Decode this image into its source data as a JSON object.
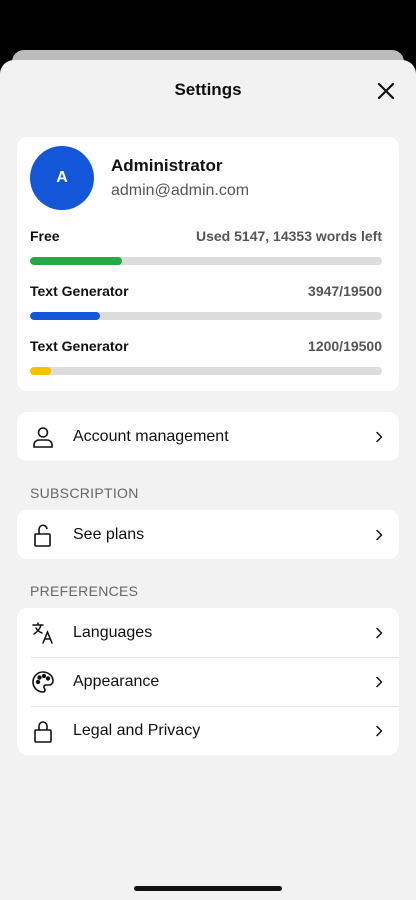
{
  "header": {
    "title": "Settings"
  },
  "profile": {
    "initial": "A",
    "name": "Administrator",
    "email": "admin@admin.com"
  },
  "usage": [
    {
      "label": "Free",
      "value": "Used 5147, 14353 words left",
      "fraction": 0.26,
      "color": "#27a844"
    },
    {
      "label": "Text Generator",
      "value": "3947/19500",
      "fraction": 0.2,
      "color": "#1357d8"
    },
    {
      "label": "Text Generator",
      "value": "1200/19500",
      "fraction": 0.06,
      "color": "#f5c000"
    }
  ],
  "account": {
    "label": "Account management",
    "icon": "person-icon"
  },
  "subscription": {
    "section_label": "SUBSCRIPTION",
    "items": [
      {
        "label": "See plans",
        "icon": "unlock-icon"
      }
    ]
  },
  "preferences": {
    "section_label": "PREFERENCES",
    "items": [
      {
        "label": "Languages",
        "icon": "translate-icon"
      },
      {
        "label": "Appearance",
        "icon": "palette-icon"
      },
      {
        "label": "Legal and Privacy",
        "icon": "lock-icon"
      }
    ]
  }
}
